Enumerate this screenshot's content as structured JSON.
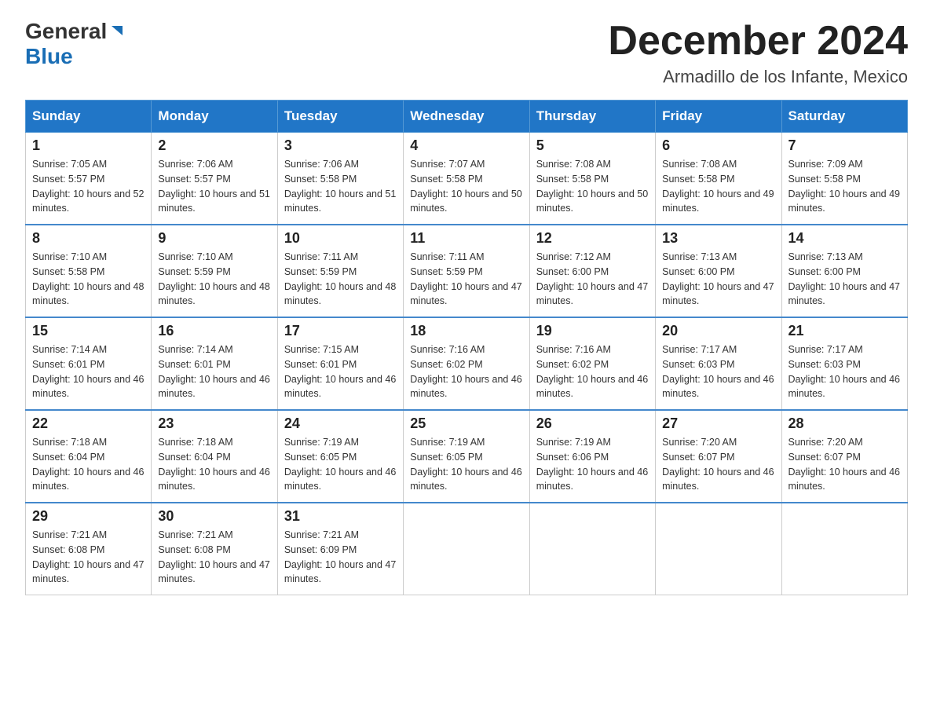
{
  "header": {
    "logo_general": "General",
    "logo_blue": "Blue",
    "month_year": "December 2024",
    "location": "Armadillo de los Infante, Mexico"
  },
  "weekdays": [
    "Sunday",
    "Monday",
    "Tuesday",
    "Wednesday",
    "Thursday",
    "Friday",
    "Saturday"
  ],
  "weeks": [
    [
      {
        "day": "1",
        "sunrise": "7:05 AM",
        "sunset": "5:57 PM",
        "daylight": "10 hours and 52 minutes."
      },
      {
        "day": "2",
        "sunrise": "7:06 AM",
        "sunset": "5:57 PM",
        "daylight": "10 hours and 51 minutes."
      },
      {
        "day": "3",
        "sunrise": "7:06 AM",
        "sunset": "5:58 PM",
        "daylight": "10 hours and 51 minutes."
      },
      {
        "day": "4",
        "sunrise": "7:07 AM",
        "sunset": "5:58 PM",
        "daylight": "10 hours and 50 minutes."
      },
      {
        "day": "5",
        "sunrise": "7:08 AM",
        "sunset": "5:58 PM",
        "daylight": "10 hours and 50 minutes."
      },
      {
        "day": "6",
        "sunrise": "7:08 AM",
        "sunset": "5:58 PM",
        "daylight": "10 hours and 49 minutes."
      },
      {
        "day": "7",
        "sunrise": "7:09 AM",
        "sunset": "5:58 PM",
        "daylight": "10 hours and 49 minutes."
      }
    ],
    [
      {
        "day": "8",
        "sunrise": "7:10 AM",
        "sunset": "5:58 PM",
        "daylight": "10 hours and 48 minutes."
      },
      {
        "day": "9",
        "sunrise": "7:10 AM",
        "sunset": "5:59 PM",
        "daylight": "10 hours and 48 minutes."
      },
      {
        "day": "10",
        "sunrise": "7:11 AM",
        "sunset": "5:59 PM",
        "daylight": "10 hours and 48 minutes."
      },
      {
        "day": "11",
        "sunrise": "7:11 AM",
        "sunset": "5:59 PM",
        "daylight": "10 hours and 47 minutes."
      },
      {
        "day": "12",
        "sunrise": "7:12 AM",
        "sunset": "6:00 PM",
        "daylight": "10 hours and 47 minutes."
      },
      {
        "day": "13",
        "sunrise": "7:13 AM",
        "sunset": "6:00 PM",
        "daylight": "10 hours and 47 minutes."
      },
      {
        "day": "14",
        "sunrise": "7:13 AM",
        "sunset": "6:00 PM",
        "daylight": "10 hours and 47 minutes."
      }
    ],
    [
      {
        "day": "15",
        "sunrise": "7:14 AM",
        "sunset": "6:01 PM",
        "daylight": "10 hours and 46 minutes."
      },
      {
        "day": "16",
        "sunrise": "7:14 AM",
        "sunset": "6:01 PM",
        "daylight": "10 hours and 46 minutes."
      },
      {
        "day": "17",
        "sunrise": "7:15 AM",
        "sunset": "6:01 PM",
        "daylight": "10 hours and 46 minutes."
      },
      {
        "day": "18",
        "sunrise": "7:16 AM",
        "sunset": "6:02 PM",
        "daylight": "10 hours and 46 minutes."
      },
      {
        "day": "19",
        "sunrise": "7:16 AM",
        "sunset": "6:02 PM",
        "daylight": "10 hours and 46 minutes."
      },
      {
        "day": "20",
        "sunrise": "7:17 AM",
        "sunset": "6:03 PM",
        "daylight": "10 hours and 46 minutes."
      },
      {
        "day": "21",
        "sunrise": "7:17 AM",
        "sunset": "6:03 PM",
        "daylight": "10 hours and 46 minutes."
      }
    ],
    [
      {
        "day": "22",
        "sunrise": "7:18 AM",
        "sunset": "6:04 PM",
        "daylight": "10 hours and 46 minutes."
      },
      {
        "day": "23",
        "sunrise": "7:18 AM",
        "sunset": "6:04 PM",
        "daylight": "10 hours and 46 minutes."
      },
      {
        "day": "24",
        "sunrise": "7:19 AM",
        "sunset": "6:05 PM",
        "daylight": "10 hours and 46 minutes."
      },
      {
        "day": "25",
        "sunrise": "7:19 AM",
        "sunset": "6:05 PM",
        "daylight": "10 hours and 46 minutes."
      },
      {
        "day": "26",
        "sunrise": "7:19 AM",
        "sunset": "6:06 PM",
        "daylight": "10 hours and 46 minutes."
      },
      {
        "day": "27",
        "sunrise": "7:20 AM",
        "sunset": "6:07 PM",
        "daylight": "10 hours and 46 minutes."
      },
      {
        "day": "28",
        "sunrise": "7:20 AM",
        "sunset": "6:07 PM",
        "daylight": "10 hours and 46 minutes."
      }
    ],
    [
      {
        "day": "29",
        "sunrise": "7:21 AM",
        "sunset": "6:08 PM",
        "daylight": "10 hours and 47 minutes."
      },
      {
        "day": "30",
        "sunrise": "7:21 AM",
        "sunset": "6:08 PM",
        "daylight": "10 hours and 47 minutes."
      },
      {
        "day": "31",
        "sunrise": "7:21 AM",
        "sunset": "6:09 PM",
        "daylight": "10 hours and 47 minutes."
      },
      null,
      null,
      null,
      null
    ]
  ],
  "labels": {
    "sunrise_prefix": "Sunrise: ",
    "sunset_prefix": "Sunset: ",
    "daylight_prefix": "Daylight: "
  }
}
